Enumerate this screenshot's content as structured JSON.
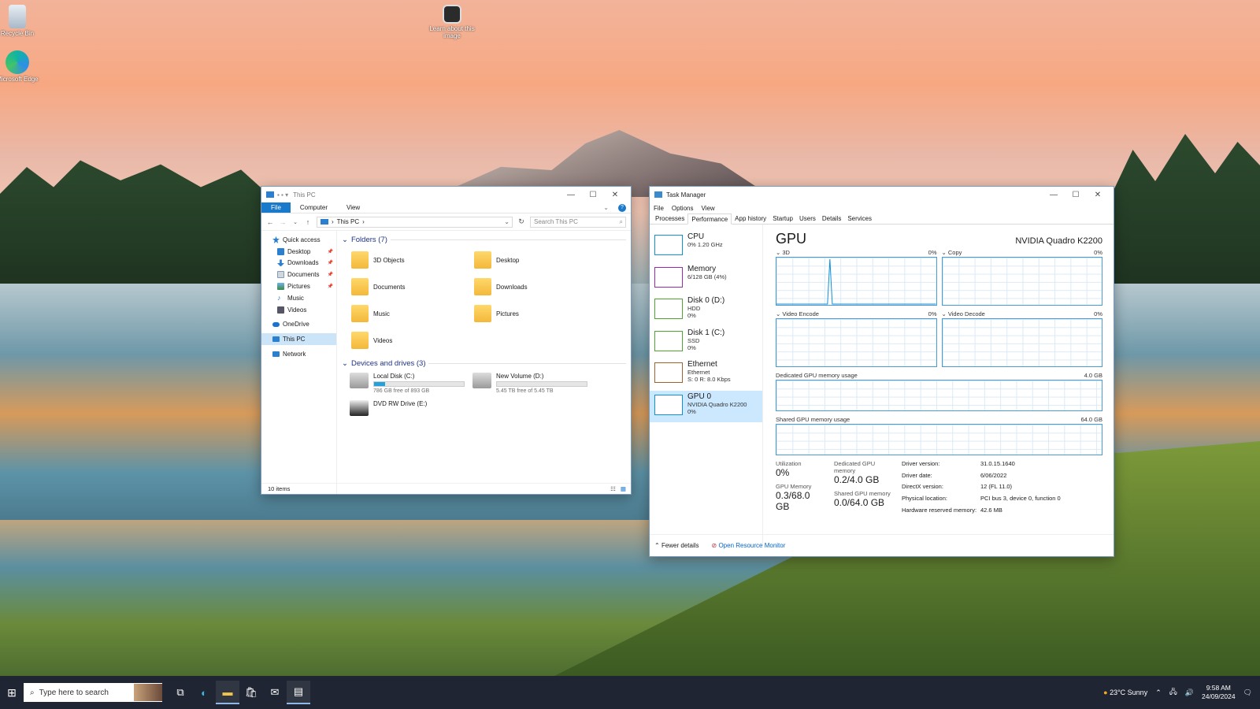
{
  "desktop": {
    "icons": [
      {
        "label": "Recycle Bin"
      },
      {
        "label": "Microsoft Edge"
      },
      {
        "label": "Learn about this image"
      }
    ]
  },
  "explorer": {
    "title": "This PC",
    "ribbon_tabs": [
      "File",
      "Computer",
      "View"
    ],
    "breadcrumb": "This PC",
    "search_placeholder": "Search This PC",
    "nav": {
      "quick_access": "Quick access",
      "items": [
        "Desktop",
        "Downloads",
        "Documents",
        "Pictures",
        "Music",
        "Videos"
      ],
      "onedrive": "OneDrive",
      "this_pc": "This PC",
      "network": "Network"
    },
    "folders_header": "Folders (7)",
    "folders": [
      "3D Objects",
      "Desktop",
      "Documents",
      "Downloads",
      "Music",
      "Pictures",
      "Videos"
    ],
    "drives_header": "Devices and drives (3)",
    "drives": [
      {
        "name": "Local Disk (C:)",
        "free": "786 GB free of 893 GB",
        "used_fraction": 0.12
      },
      {
        "name": "New Volume (D:)",
        "free": "5.45 TB free of 5.45 TB",
        "used_fraction": 0.0
      },
      {
        "name": "DVD RW Drive (E:)",
        "free": "",
        "used_fraction": null
      }
    ],
    "status": "10 items"
  },
  "taskmgr": {
    "title": "Task Manager",
    "menu": [
      "File",
      "Options",
      "View"
    ],
    "tabs": [
      "Processes",
      "Performance",
      "App history",
      "Startup",
      "Users",
      "Details",
      "Services"
    ],
    "active_tab": "Performance",
    "perf_items": [
      {
        "name": "CPU",
        "line1": "0% 1.20 GHz",
        "line2": "",
        "color": "#1190da"
      },
      {
        "name": "Memory",
        "line1": "6/128 GB (4%)",
        "line2": "",
        "color": "#9a28b5"
      },
      {
        "name": "Disk 0 (D:)",
        "line1": "HDD",
        "line2": "0%",
        "color": "#4ca82e"
      },
      {
        "name": "Disk 1 (C:)",
        "line1": "SSD",
        "line2": "0%",
        "color": "#4ca82e"
      },
      {
        "name": "Ethernet",
        "line1": "Ethernet",
        "line2": "S: 0 R: 8.0 Kbps",
        "color": "#a4622a"
      },
      {
        "name": "GPU 0",
        "line1": "NVIDIA Quadro K2200",
        "line2": "0%",
        "color": "#1190da"
      }
    ],
    "detail": {
      "title": "GPU",
      "device": "NVIDIA Quadro K2200",
      "graphs": [
        {
          "label": "3D",
          "value": "0%"
        },
        {
          "label": "Copy",
          "value": "0%"
        },
        {
          "label": "Video Encode",
          "value": "0%"
        },
        {
          "label": "Video Decode",
          "value": "0%"
        }
      ],
      "dedicated_label": "Dedicated GPU memory usage",
      "dedicated_max": "4.0 GB",
      "shared_label": "Shared GPU memory usage",
      "shared_max": "64.0 GB",
      "stats": {
        "utilization_label": "Utilization",
        "utilization": "0%",
        "dedicated_label": "Dedicated GPU memory",
        "dedicated": "0.2/4.0 GB",
        "gpumem_label": "GPU Memory",
        "gpumem": "0.3/68.0 GB",
        "sharedmem_label": "Shared GPU memory",
        "sharedmem": "0.0/64.0 GB"
      },
      "info": [
        {
          "k": "Driver version:",
          "v": "31.0.15.1640"
        },
        {
          "k": "Driver date:",
          "v": "6/06/2022"
        },
        {
          "k": "DirectX version:",
          "v": "12 (FL 11.0)"
        },
        {
          "k": "Physical location:",
          "v": "PCI bus 3, device 0, function 0"
        },
        {
          "k": "Hardware reserved memory:",
          "v": "42.6 MB"
        }
      ]
    },
    "fewer_details": "Fewer details",
    "resource_monitor": "Open Resource Monitor"
  },
  "taskbar": {
    "search_placeholder": "Type here to search",
    "weather": "23°C  Sunny",
    "time": "9:58 AM",
    "date": "24/09/2024"
  }
}
